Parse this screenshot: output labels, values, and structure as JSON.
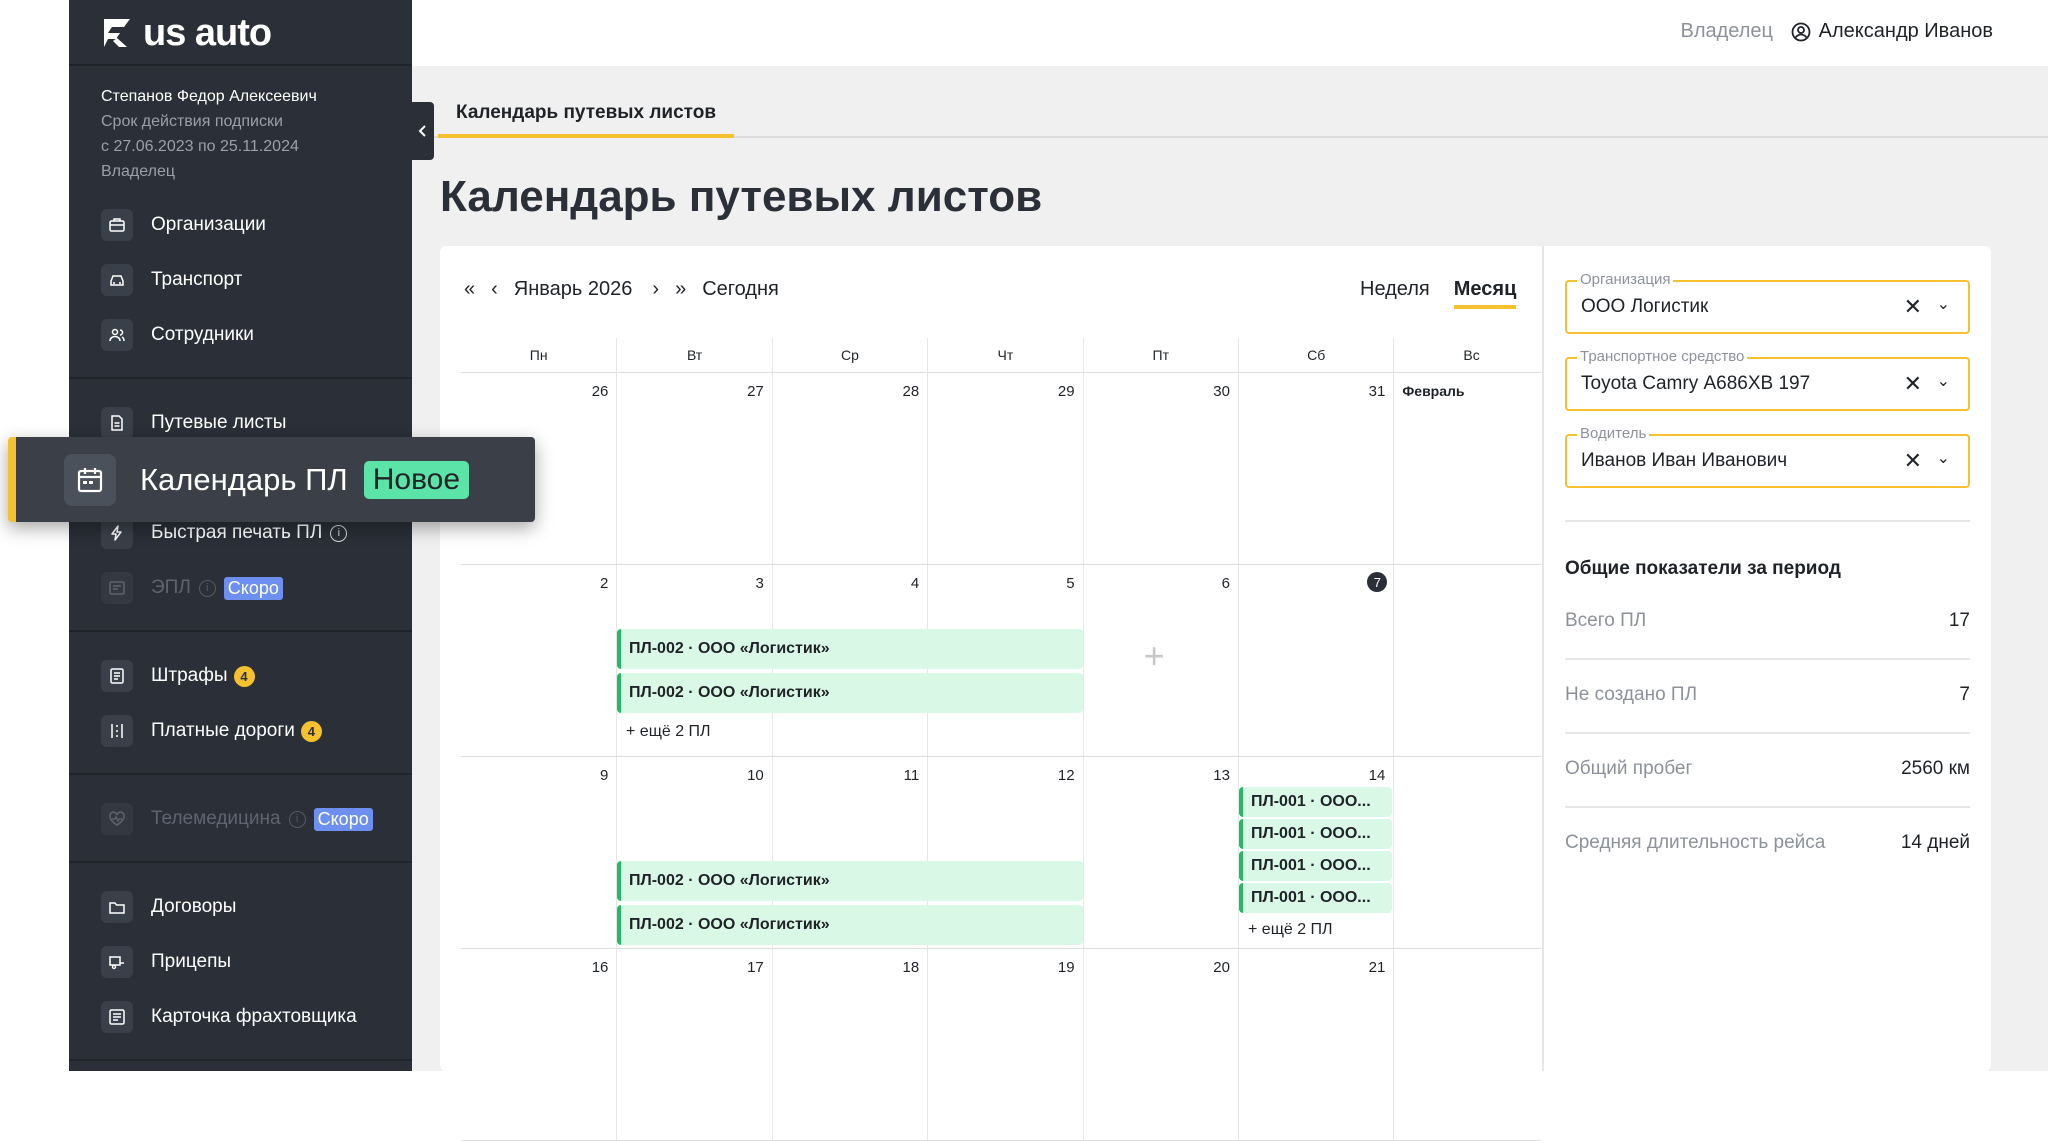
{
  "brand": {
    "name": "us auto",
    "accent": "#f5c12e"
  },
  "user_info": {
    "name": "Степанов Федор Алексеевич",
    "sub_label": "Срок действия подписки",
    "period": "с 27.06.2023 по 25.11.2024",
    "role": "Владелец"
  },
  "sidebar": {
    "items": [
      {
        "label": "Организации"
      },
      {
        "label": "Транспорт"
      },
      {
        "label": "Сотрудники"
      },
      {
        "label": "Путевые листы"
      },
      {
        "label": "Быстрая печать ПЛ"
      },
      {
        "label": "ЭПЛ",
        "badge": "Скоро"
      },
      {
        "label": "Штрафы",
        "count": "4"
      },
      {
        "label": "Платные дороги",
        "count": "4"
      },
      {
        "label": "Телемедицина",
        "badge": "Скоро"
      },
      {
        "label": "Договоры"
      },
      {
        "label": "Прицепы"
      },
      {
        "label": "Карточка фрахтовщика"
      }
    ],
    "highlight": {
      "label": "Календарь ПЛ",
      "badge": "Новое"
    }
  },
  "header": {
    "role": "Владелец",
    "user": "Александр Иванов"
  },
  "tab": {
    "label": "Календарь путевых листов"
  },
  "page_title": "Календарь путевых листов",
  "calendar": {
    "month": "Январь 2026",
    "today_label": "Сегодня",
    "views": [
      "Неделя",
      "Месяц"
    ],
    "weekdays": [
      "Пн",
      "Вт",
      "Ср",
      "Чт",
      "Пт",
      "Сб",
      "Вс"
    ],
    "weeks": [
      [
        "26",
        "27",
        "28",
        "29",
        "30",
        "31",
        ""
      ],
      [
        "2",
        "3",
        "4",
        "5",
        "6",
        "7",
        ""
      ],
      [
        "9",
        "10",
        "11",
        "12",
        "13",
        "14",
        ""
      ],
      [
        "16",
        "17",
        "18",
        "19",
        "20",
        "21",
        ""
      ]
    ],
    "feb_label": "Февраль",
    "events": {
      "w2_a": "ПЛ-002 · ООО «Логистик»",
      "w2_b": "ПЛ-002 · ООО «Логистик»",
      "w2_more": "+ ещё 2 ПЛ",
      "w3_a": "ПЛ-002 · ООО «Логистик»",
      "w3_b": "ПЛ-002 · ООО «Логистик»",
      "w3_sat_1": "ПЛ-001 · ООО...",
      "w3_sat_2": "ПЛ-001 · ООО...",
      "w3_sat_3": "ПЛ-001 · ООО...",
      "w3_sat_4": "ПЛ-001 · ООО...",
      "w3_sat_more": "+ ещё 2 ПЛ"
    },
    "add_icon": "+"
  },
  "filters": {
    "org": {
      "label": "Организация",
      "value": "ООО Логистик"
    },
    "vehicle": {
      "label": "Транспортное средство",
      "value": "Toyota Camry А686ХВ 197"
    },
    "driver": {
      "label": "Водитель",
      "value": "Иванов Иван Иванович"
    }
  },
  "stats": {
    "title": "Общие показатели за период",
    "items": [
      {
        "label": "Всего ПЛ",
        "value": "17"
      },
      {
        "label": "Не создано ПЛ",
        "value": "7"
      },
      {
        "label": "Общий пробег",
        "value": "2560 км"
      },
      {
        "label": "Средняя длительность рейса",
        "value": "14 дней"
      }
    ]
  }
}
